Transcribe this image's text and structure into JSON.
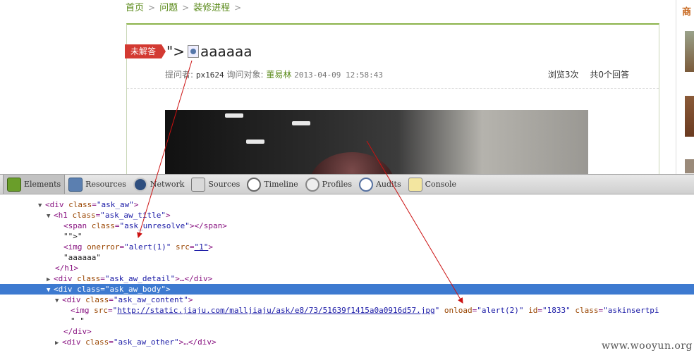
{
  "breadcrumb": {
    "items": [
      "首页",
      "问题",
      "装修进程"
    ],
    "separator": ">"
  },
  "question": {
    "status": "未解答",
    "title_prefix": "\">",
    "title_text": "aaaaaa",
    "meta": {
      "asker_label": "提问者:",
      "asker": "px1624",
      "expert_label": "询问对象:",
      "expert": "董易林",
      "datetime": "2013-04-09 12:58:43"
    },
    "views": "浏览3次",
    "answers": "共0个回答"
  },
  "sidebar": {
    "title": "商"
  },
  "devtools": {
    "tabs": [
      {
        "label": "Elements",
        "icon": "elements-icon"
      },
      {
        "label": "Resources",
        "icon": "resources-icon"
      },
      {
        "label": "Network",
        "icon": "network-icon"
      },
      {
        "label": "Sources",
        "icon": "sources-icon"
      },
      {
        "label": "Timeline",
        "icon": "timeline-icon"
      },
      {
        "label": "Profiles",
        "icon": "profiles-icon"
      },
      {
        "label": "Audits",
        "icon": "audits-icon"
      },
      {
        "label": "Console",
        "icon": "console-icon"
      }
    ],
    "dom": {
      "l1_tag": "<div ",
      "l1_attr": "class",
      "l1_val": "\"ask_aw\"",
      "l1_end": ">",
      "l2_tag": "<h1 ",
      "l2_attr": "class",
      "l2_val": "\"ask_aw_title\"",
      "l2_end": ">",
      "l3_tag": "<span ",
      "l3_attr": "class",
      "l3_val": "\"ask_unresolve\"",
      "l3_end": "></span>",
      "l4_text": "\"\">\"",
      "l5_tag": "<img ",
      "l5_attr1": "onerror",
      "l5_val1": "\"alert(1)\"",
      "l5_attr2": "src",
      "l5_val2": "\"1\"",
      "l5_end": ">",
      "l6_text": "\"aaaaaa\"",
      "l7_tag": "</h1>",
      "l8_tag": "<div ",
      "l8_attr": "class",
      "l8_val": "\"ask_aw_detail\"",
      "l8_end": ">…</div>",
      "l9_tag": "<div ",
      "l9_attr": "class",
      "l9_val": "\"ask_aw_body\"",
      "l9_end": ">",
      "l10_tag": "<div ",
      "l10_attr": "class",
      "l10_val": "\"ask_aw_content\"",
      "l10_end": ">",
      "l11_tag": "<img ",
      "l11_attr1": "src",
      "l11_val1": "http://static.jiaju.com/malljiaju/ask/e8/73/51639f1415a0a0916d57.jpg",
      "l11_attr2": "onload",
      "l11_val2": "\"alert(2)\"",
      "l11_attr3": "id",
      "l11_val3": "\"1833\"",
      "l11_attr4": "class",
      "l11_val4": "\"askinsertpi",
      "l12_text": "\" \"",
      "l13_tag": "</div>",
      "l14_tag": "<div ",
      "l14_attr": "class",
      "l14_val": "\"ask_aw_other\"",
      "l14_end": ">…</div>"
    }
  },
  "watermark": "www.wooyun.org",
  "colors": {
    "brand_green": "#5a8a1a",
    "badge_red": "#d33a32",
    "selection_blue": "#3d7ad0",
    "arrow_red": "#cc1111"
  }
}
